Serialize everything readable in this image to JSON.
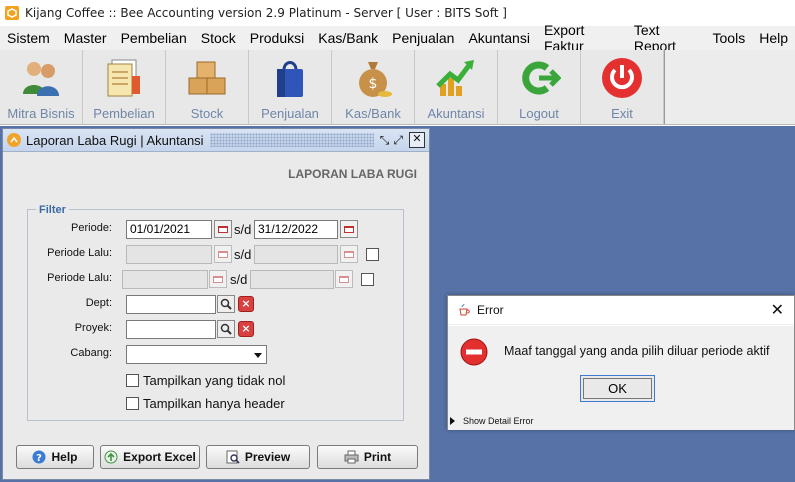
{
  "window": {
    "title": "Kijang Coffee :: Bee Accounting version 2.9 Platinum - Server  [ User : BITS Soft ]"
  },
  "menu": [
    "Sistem",
    "Master",
    "Pembelian",
    "Stock",
    "Produksi",
    "Kas/Bank",
    "Penjualan",
    "Akuntansi",
    "Export Faktur",
    "Text Report",
    "Tools",
    "Help"
  ],
  "toolbar": [
    {
      "label": "Mitra Bisnis",
      "icon": "people-icon"
    },
    {
      "label": "Pembelian",
      "icon": "documents-icon"
    },
    {
      "label": "Stock",
      "icon": "boxes-icon"
    },
    {
      "label": "Penjualan",
      "icon": "shopping-bag-icon"
    },
    {
      "label": "Kas/Bank",
      "icon": "money-bag-icon"
    },
    {
      "label": "Akuntansi",
      "icon": "growth-chart-icon"
    },
    {
      "label": "Logout",
      "icon": "logout-arrow-icon"
    },
    {
      "label": "Exit",
      "icon": "power-icon"
    }
  ],
  "frame": {
    "title": "Laporan Laba Rugi | Akuntansi",
    "heading": "LAPORAN LABA RUGI"
  },
  "filter": {
    "legend": "Filter",
    "periode_label": "Periode:",
    "periode_from": "01/01/2021",
    "sd": "s/d",
    "periode_to": "31/12/2022",
    "periode_lalu_label": "Periode Lalu:",
    "dept_label": "Dept:",
    "proyek_label": "Proyek:",
    "cabang_label": "Cabang:",
    "show_unused": "Tampilkan yang tidak nol",
    "header_only": "Tampilkan hanya header"
  },
  "buttons": {
    "help": "Help",
    "export": "Export Excel",
    "preview": "Preview",
    "print": "Print"
  },
  "dialog": {
    "title": "Error",
    "message": "Maaf tanggal yang anda pilih diluar periode aktif",
    "ok": "OK",
    "detail": "Show Detail Error"
  },
  "colors": {
    "desktop": "#5672a6",
    "toolbar_text": "#6e86a8",
    "legend": "#3b6aa6"
  }
}
